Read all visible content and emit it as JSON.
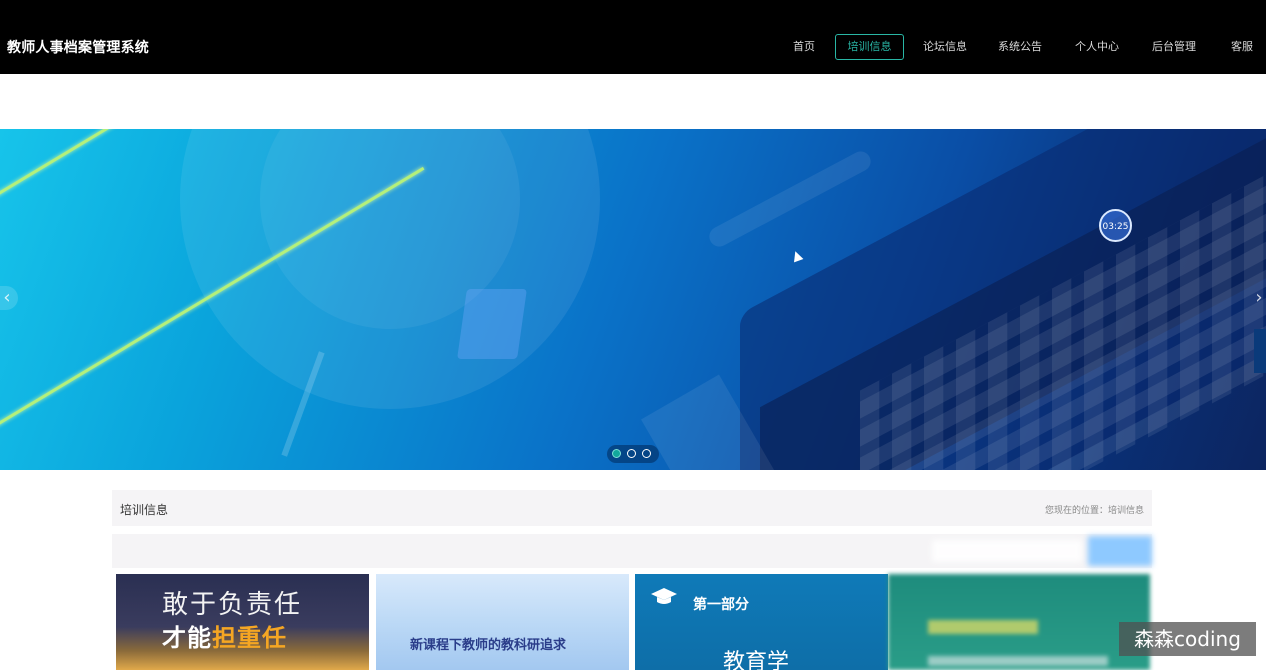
{
  "header": {
    "site_title": "教师人事档案管理系统",
    "nav": [
      {
        "label": "首页",
        "active": false
      },
      {
        "label": "培训信息",
        "active": true
      },
      {
        "label": "论坛信息",
        "active": false
      },
      {
        "label": "系统公告",
        "active": false
      },
      {
        "label": "个人中心",
        "active": false
      },
      {
        "label": "后台管理",
        "active": false
      },
      {
        "label": "客服",
        "active": false
      }
    ]
  },
  "banner": {
    "timer_text": "03:25",
    "slide_count": 3,
    "active_slide": 1,
    "prev_icon": "chevron-left-icon",
    "next_icon": "chevron-right-icon"
  },
  "section": {
    "title": "培训信息",
    "breadcrumb": "您现在的位置：培训信息"
  },
  "cards": [
    {
      "line1": "敢于负责任",
      "line2_prefix": "才能",
      "line2_highlight": "担重任"
    },
    {
      "title": "新课程下教师的教科研追求"
    },
    {
      "part": "第一部分",
      "subject": "教育学"
    },
    {}
  ],
  "watermark": "森森coding",
  "colors": {
    "accent": "#29b6a5",
    "header_bg": "#000000",
    "section_bg": "#f5f4f6"
  }
}
